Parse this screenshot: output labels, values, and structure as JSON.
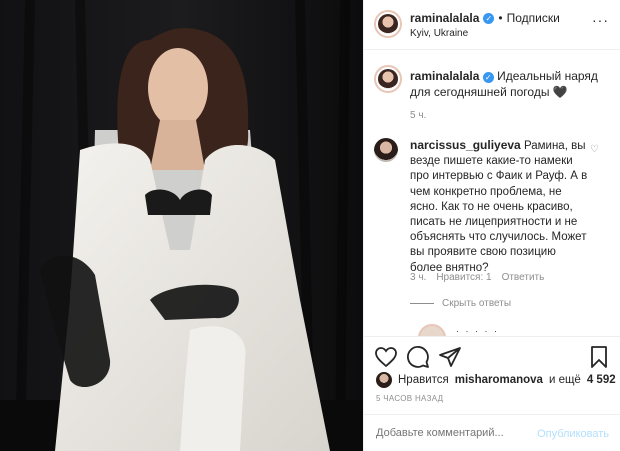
{
  "post": {
    "username": "raminalalala",
    "follow_separator": "•",
    "follow_label": "Подписки",
    "location": "Kyiv, Ukraine",
    "more": "···"
  },
  "caption": {
    "username": "raminalalala",
    "text": "Идеальный наряд для сегодняшней погоды 🖤",
    "time": "5 ч."
  },
  "comment": {
    "username": "narcissus_guliyeva",
    "text": "Рамина, вы везде пишете какие-то намеки про интервью с Фаик и Рауф. А в чем конкретно проблема, не ясно. Как то не очень красиво, писать не лицеприятности и не объяснять что случилось. Может вы проявите свою позицию более внятно?",
    "time": "3 ч.",
    "likes": "Нравится: 1",
    "reply": "Ответить",
    "hide_replies": "Скрыть ответы"
  },
  "likes": {
    "prefix": "Нравится",
    "user": "misharomanova",
    "and_more": "и ещё",
    "count": "4 592"
  },
  "post_time": "5 ЧАСОВ НАЗАД",
  "add_comment": {
    "placeholder": "Добавьте комментарий...",
    "publish": "Опубликовать"
  },
  "colors": {
    "accent": "#3897f0",
    "publish_disabled": "#b2dffc",
    "muted": "#8e8e8e"
  },
  "icons": [
    "heart-icon",
    "comment-icon",
    "share-icon",
    "bookmark-icon",
    "verified-icon",
    "more-icon"
  ]
}
